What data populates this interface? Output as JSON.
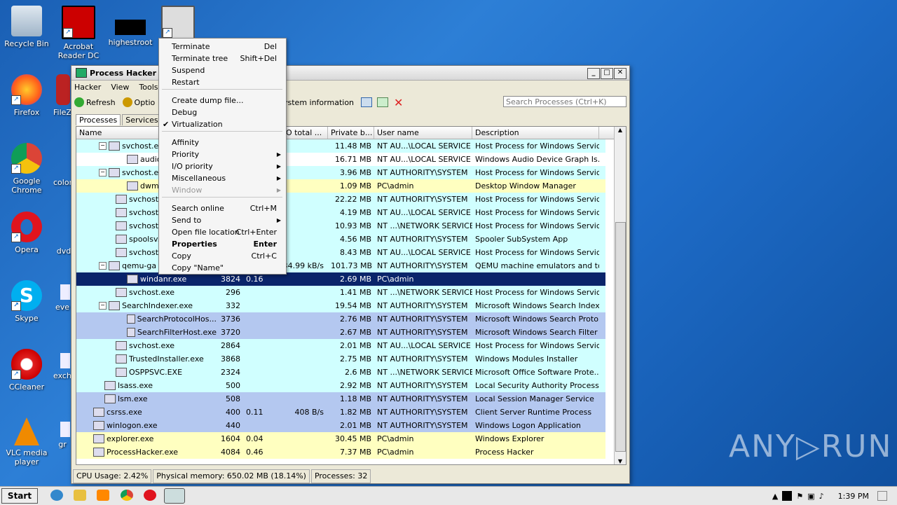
{
  "desktop": {
    "icons": [
      {
        "label": "Recycle Bin"
      },
      {
        "label": "Acrobat Reader DC"
      },
      {
        "label": "highestroot"
      },
      {
        "label": "Firefox"
      },
      {
        "label": "FileZ"
      },
      {
        "label": "Google Chrome"
      },
      {
        "label": "color"
      },
      {
        "label": "Opera"
      },
      {
        "label": "dvd"
      },
      {
        "label": "Skype"
      },
      {
        "label": "eve"
      },
      {
        "label": "CCleaner"
      },
      {
        "label": "exch"
      },
      {
        "label": "VLC media player"
      },
      {
        "label": "gr"
      }
    ],
    "watermark": "ANY▷RUN"
  },
  "window": {
    "title": "Process Hacker [P",
    "menu": [
      "Hacker",
      "View",
      "Tools"
    ],
    "toolbar": {
      "refresh": "Refresh",
      "options": "Optio",
      "sysinfo": "ystem information"
    },
    "search_placeholder": "Search Processes (Ctrl+K)",
    "tabs": [
      "Processes",
      "Services"
    ],
    "columns": [
      "Name",
      "",
      "",
      "I/O total ...",
      "Private b...",
      "User name",
      "Description"
    ],
    "rows": [
      {
        "name": "svchost.e",
        "pid": "",
        "cpu": "",
        "io": "",
        "priv": "11.48 MB",
        "user": "NT AU...\\LOCAL SERVICE",
        "desc": "Host Process for Windows Services"
      },
      {
        "name": "audio",
        "pid": "",
        "cpu": "",
        "io": "",
        "priv": "16.71 MB",
        "user": "NT AU...\\LOCAL SERVICE",
        "desc": "Windows Audio Device Graph Is..."
      },
      {
        "name": "svchost.e",
        "pid": "",
        "cpu": "",
        "io": "",
        "priv": "3.96 MB",
        "user": "NT AUTHORITY\\SYSTEM",
        "desc": "Host Process for Windows Services"
      },
      {
        "name": "dwm.",
        "pid": "",
        "cpu": "",
        "io": "",
        "priv": "1.09 MB",
        "user": "PC\\admin",
        "desc": "Desktop Window Manager"
      },
      {
        "name": "svchost.e",
        "pid": "",
        "cpu": "",
        "io": "",
        "priv": "22.22 MB",
        "user": "NT AUTHORITY\\SYSTEM",
        "desc": "Host Process for Windows Services"
      },
      {
        "name": "svchost.e",
        "pid": "",
        "cpu": "",
        "io": "",
        "priv": "4.19 MB",
        "user": "NT AU...\\LOCAL SERVICE",
        "desc": "Host Process for Windows Services"
      },
      {
        "name": "svchost.e",
        "pid": "",
        "cpu": "",
        "io": "",
        "priv": "10.93 MB",
        "user": "NT ...\\NETWORK SERVICE",
        "desc": "Host Process for Windows Services"
      },
      {
        "name": "spoolsv.e",
        "pid": "",
        "cpu": "",
        "io": "",
        "priv": "4.56 MB",
        "user": "NT AUTHORITY\\SYSTEM",
        "desc": "Spooler SubSystem App"
      },
      {
        "name": "svchost.e",
        "pid": "",
        "cpu": "",
        "io": "",
        "priv": "8.43 MB",
        "user": "NT AU...\\LOCAL SERVICE",
        "desc": "Host Process for Windows Services"
      },
      {
        "name": "qemu-ga",
        "pid": "",
        "cpu": "",
        "io": "34.99 kB/s",
        "priv": "101.73 MB",
        "user": "NT AUTHORITY\\SYSTEM",
        "desc": "QEMU machine emulators and tools"
      },
      {
        "name": "windanr.exe",
        "pid": "3824",
        "cpu": "0.16",
        "io": "",
        "priv": "2.69 MB",
        "user": "PC\\admin",
        "desc": ""
      },
      {
        "name": "svchost.exe",
        "pid": "296",
        "cpu": "",
        "io": "",
        "priv": "1.41 MB",
        "user": "NT ...\\NETWORK SERVICE",
        "desc": "Host Process for Windows Services"
      },
      {
        "name": "SearchIndexer.exe",
        "pid": "332",
        "cpu": "",
        "io": "",
        "priv": "19.54 MB",
        "user": "NT AUTHORITY\\SYSTEM",
        "desc": "Microsoft Windows Search Indexer"
      },
      {
        "name": "SearchProtocolHos...",
        "pid": "3736",
        "cpu": "",
        "io": "",
        "priv": "2.76 MB",
        "user": "NT AUTHORITY\\SYSTEM",
        "desc": "Microsoft Windows Search Proto..."
      },
      {
        "name": "SearchFilterHost.exe",
        "pid": "3720",
        "cpu": "",
        "io": "",
        "priv": "2.67 MB",
        "user": "NT AUTHORITY\\SYSTEM",
        "desc": "Microsoft Windows Search Filter ..."
      },
      {
        "name": "svchost.exe",
        "pid": "2864",
        "cpu": "",
        "io": "",
        "priv": "2.01 MB",
        "user": "NT AU...\\LOCAL SERVICE",
        "desc": "Host Process for Windows Services"
      },
      {
        "name": "TrustedInstaller.exe",
        "pid": "3868",
        "cpu": "",
        "io": "",
        "priv": "2.75 MB",
        "user": "NT AUTHORITY\\SYSTEM",
        "desc": "Windows Modules Installer"
      },
      {
        "name": "OSPPSVC.EXE",
        "pid": "2324",
        "cpu": "",
        "io": "",
        "priv": "2.6 MB",
        "user": "NT ...\\NETWORK SERVICE",
        "desc": "Microsoft Office Software Prote..."
      },
      {
        "name": "lsass.exe",
        "pid": "500",
        "cpu": "",
        "io": "",
        "priv": "2.92 MB",
        "user": "NT AUTHORITY\\SYSTEM",
        "desc": "Local Security Authority Process"
      },
      {
        "name": "lsm.exe",
        "pid": "508",
        "cpu": "",
        "io": "",
        "priv": "1.18 MB",
        "user": "NT AUTHORITY\\SYSTEM",
        "desc": "Local Session Manager Service"
      },
      {
        "name": "csrss.exe",
        "pid": "400",
        "cpu": "0.11",
        "io": "408 B/s",
        "priv": "1.82 MB",
        "user": "NT AUTHORITY\\SYSTEM",
        "desc": "Client Server Runtime Process"
      },
      {
        "name": "winlogon.exe",
        "pid": "440",
        "cpu": "",
        "io": "",
        "priv": "2.01 MB",
        "user": "NT AUTHORITY\\SYSTEM",
        "desc": "Windows Logon Application"
      },
      {
        "name": "explorer.exe",
        "pid": "1604",
        "cpu": "0.04",
        "io": "",
        "priv": "30.45 MB",
        "user": "PC\\admin",
        "desc": "Windows Explorer"
      },
      {
        "name": "ProcessHacker.exe",
        "pid": "4084",
        "cpu": "0.46",
        "io": "",
        "priv": "7.37 MB",
        "user": "PC\\admin",
        "desc": "Process Hacker"
      }
    ],
    "status": {
      "cpu": "CPU Usage: 2.42%",
      "mem": "Physical memory: 650.02 MB (18.14%)",
      "procs": "Processes: 32"
    }
  },
  "context_menu": [
    {
      "label": "Terminate",
      "shortcut": "Del"
    },
    {
      "label": "Terminate tree",
      "shortcut": "Shift+Del"
    },
    {
      "label": "Suspend",
      "shortcut": ""
    },
    {
      "label": "Restart",
      "shortcut": ""
    },
    {
      "label": "Create dump file...",
      "shortcut": ""
    },
    {
      "label": "Debug",
      "shortcut": ""
    },
    {
      "label": "Virtualization",
      "shortcut": "",
      "checked": "✔"
    },
    {
      "label": "Affinity",
      "shortcut": ""
    },
    {
      "label": "Priority",
      "shortcut": "",
      "submenu": "▶"
    },
    {
      "label": "I/O priority",
      "shortcut": "",
      "submenu": "▶"
    },
    {
      "label": "Miscellaneous",
      "shortcut": "",
      "submenu": "▶"
    },
    {
      "label": "Window",
      "shortcut": "",
      "submenu": "▶"
    },
    {
      "label": "Search online",
      "shortcut": "Ctrl+M"
    },
    {
      "label": "Send to",
      "shortcut": "",
      "submenu": "▶"
    },
    {
      "label": "Open file location",
      "shortcut": "Ctrl+Enter"
    },
    {
      "label": "Properties",
      "shortcut": "Enter"
    },
    {
      "label": "Copy",
      "shortcut": "Ctrl+C"
    },
    {
      "label": "Copy \"Name\"",
      "shortcut": ""
    }
  ],
  "taskbar": {
    "start": "Start",
    "clock": "1:39 PM"
  },
  "colors": {
    "service": "#d0ffff",
    "own": "#ffffc0",
    "system": "#b4c8f0",
    "selected": "#0a246a",
    "desktop": "#1e6cc8"
  }
}
